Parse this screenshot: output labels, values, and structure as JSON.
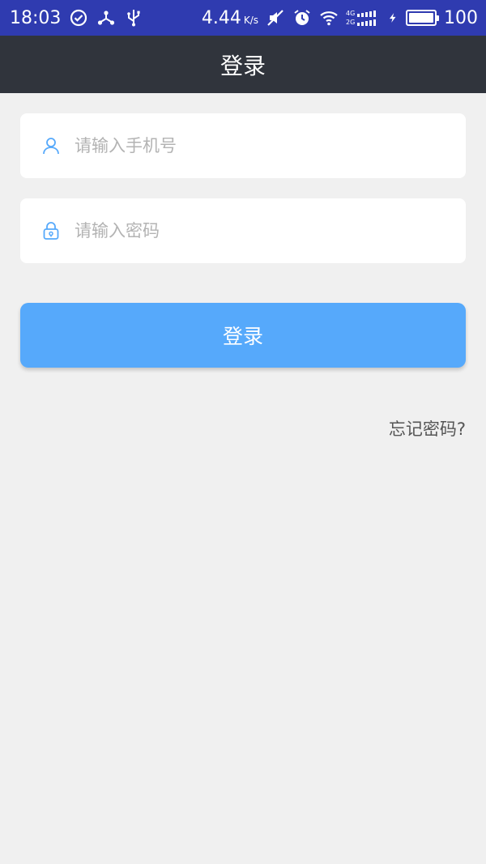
{
  "status_bar": {
    "time": "18:03",
    "speed_value": "4.44",
    "speed_unit": "K/s",
    "net_top": "4G",
    "net_bottom": "2G",
    "battery": "100",
    "icons": [
      "check-circle-icon",
      "network-share-icon",
      "usb-icon",
      "mute-icon",
      "alarm-icon",
      "wifi-icon",
      "signal-icon",
      "charging-icon",
      "battery-icon"
    ],
    "color": "#2f3bb0"
  },
  "app_bar": {
    "title": "登录",
    "color": "#30343c"
  },
  "form": {
    "phone_placeholder": "请输入手机号",
    "password_placeholder": "请输入密码",
    "phone_icon": "user-icon",
    "password_icon": "lock-icon",
    "icon_color": "#56a9fb"
  },
  "login_button": {
    "label": "登录",
    "color": "#56a9fb"
  },
  "forgot_password": "忘记密码?"
}
